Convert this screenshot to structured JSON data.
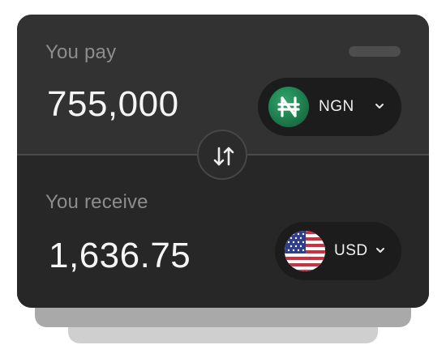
{
  "pay": {
    "label": "You pay",
    "amount": "755,000",
    "currency": {
      "code": "NGN",
      "icon": "naira-icon",
      "icon_color": "#1f7a4d"
    }
  },
  "receive": {
    "label": "You receive",
    "amount": "1,636.75",
    "currency": {
      "code": "USD",
      "icon": "us-flag-icon"
    }
  },
  "swap": {
    "icon": "swap-vertical-icon"
  },
  "colors": {
    "card_top": "#323232",
    "card_bottom": "#272727",
    "selector_bg": "#1c1c1c",
    "label_text": "#8d8d8d",
    "amount_text": "#f5f5f5"
  }
}
